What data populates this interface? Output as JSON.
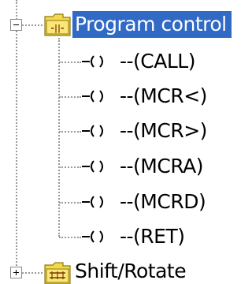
{
  "tree": {
    "group_program_control": {
      "label": "Program control",
      "icon": "folder-ladder-icon",
      "expanded": true,
      "selected": true,
      "children": [
        {
          "label": "--(CALL)",
          "icon": "coil-icon"
        },
        {
          "label": "--(MCR<)",
          "icon": "coil-icon"
        },
        {
          "label": "--(MCR>)",
          "icon": "coil-icon"
        },
        {
          "label": "--(MCRA)",
          "icon": "coil-icon"
        },
        {
          "label": "--(MCRD)",
          "icon": "coil-icon"
        },
        {
          "label": "--(RET)",
          "icon": "coil-icon"
        }
      ]
    },
    "group_shift_rotate": {
      "label": "Shift/Rotate",
      "icon": "folder-ladder-icon",
      "expanded": false,
      "selected": false
    }
  },
  "colors": {
    "selection_bg": "#316ac5",
    "selection_text": "#ffffff",
    "folder_yellow": "#f4d84a",
    "tree_line": "#9a9a9a"
  }
}
